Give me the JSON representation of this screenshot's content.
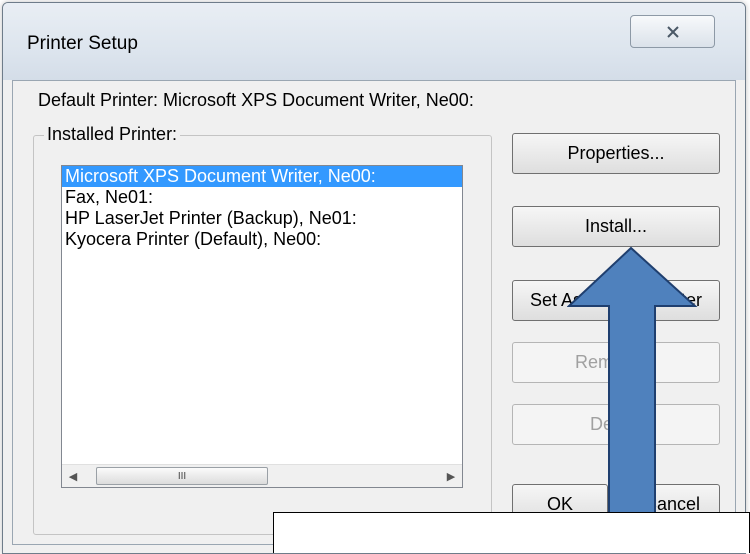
{
  "window": {
    "title": "Printer Setup",
    "close_symbol": "✕"
  },
  "dialog": {
    "default_printer_text": "Default Printer: Microsoft XPS Document Writer, Ne00:",
    "installed_group_label": "Installed Printer:",
    "printers": [
      {
        "label": "Microsoft XPS Document Writer, Ne00:",
        "selected": true
      },
      {
        "label": "Fax, Ne01:",
        "selected": false
      },
      {
        "label": "HP LaserJet Printer (Backup), Ne01:",
        "selected": false
      },
      {
        "label": "Kyocera Printer (Default), Ne00:",
        "selected": false
      }
    ],
    "scrollbar": {
      "left_arrow": "◀",
      "right_arrow": "▶",
      "thumb_grip": "III"
    },
    "buttons": {
      "properties": "Properties...",
      "install": "Install...",
      "set_default": "Set As Default Printer",
      "remove": "Remove...",
      "delete": "Delete",
      "ok": "OK",
      "cancel": "Cancel"
    }
  },
  "annotation": {
    "arrow_color": "#4f81bd",
    "arrow_outline": "#1f3f6f"
  }
}
